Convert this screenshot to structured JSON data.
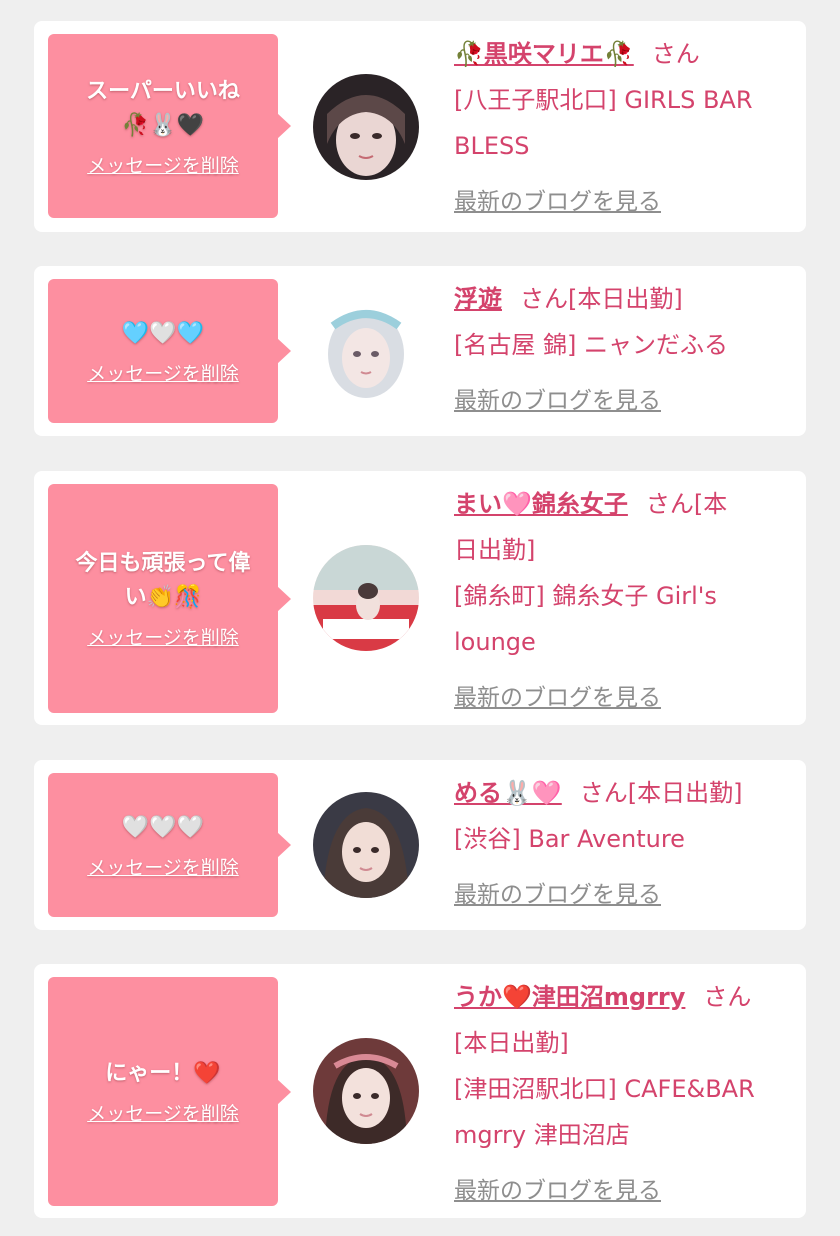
{
  "colors": {
    "background": "#efefef",
    "card": "#ffffff",
    "bubble": "#fd8fa0",
    "accent_text": "#d4436c",
    "muted_link": "#8e8e8e"
  },
  "delete_label": "メッセージを削除",
  "blog_label": "最新のブログを見る",
  "items": [
    {
      "message": "スーパーいいね\n🥀🐰🖤",
      "name": "🥀黒咲マリエ🥀",
      "san": "さん",
      "shop_lines": [
        "[八王子駅北口] GIRLS BAR",
        "BLESS"
      ]
    },
    {
      "message": "🩵🤍🩵",
      "name": "浮遊",
      "san": "さん[本日出勤]",
      "shop_lines": [
        "[名古屋 錦] ニャンだふる"
      ]
    },
    {
      "message": "今日も頑張って偉\nい👏🎊",
      "name": "まい🩷錦糸女子",
      "san": "さん[本",
      "name_line2": "日出勤]",
      "shop_lines": [
        "[錦糸町] 錦糸女子 Girl's",
        "lounge"
      ]
    },
    {
      "message": "🤍🤍🤍",
      "name": "める🐰🩷",
      "san": "さん[本日出勤]",
      "shop_lines": [
        "[渋谷] Bar Aventure"
      ]
    },
    {
      "message": "にゃー！❤️",
      "name": "うか❤️津田沼mgrry",
      "san": "さん",
      "name_line2": "[本日出勤]",
      "shop_lines": [
        "[津田沼駅北口] CAFE&BAR",
        "mgrry 津田沼店"
      ]
    }
  ]
}
